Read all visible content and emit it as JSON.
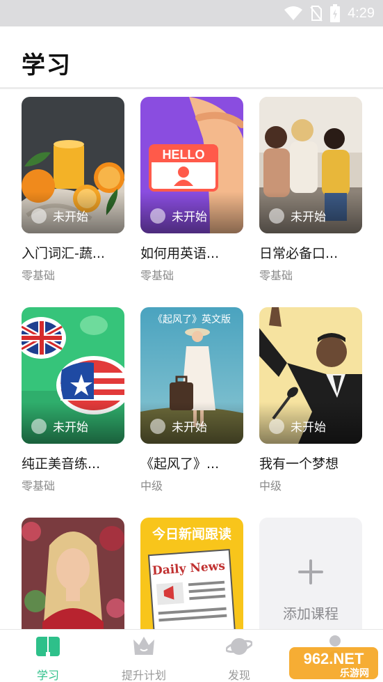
{
  "status_bar": {
    "time": "4:29",
    "icons": [
      "wifi-icon",
      "no-sim-icon",
      "battery-charging-icon"
    ]
  },
  "header": {
    "title": "学习"
  },
  "courses": [
    {
      "title": "入门词汇-蔬...",
      "level": "零基础",
      "status": "未开始",
      "image": "fruit"
    },
    {
      "title": "如何用英语...",
      "level": "零基础",
      "status": "未开始",
      "image": "hello-badge",
      "image_text": "HELLO"
    },
    {
      "title": "日常必备口...",
      "level": "零基础",
      "status": "未开始",
      "image": "friends"
    },
    {
      "title": "纯正美音练...",
      "level": "零基础",
      "status": "未开始",
      "image": "flags"
    },
    {
      "title": "《起风了》...",
      "level": "中级",
      "status": "未开始",
      "image": "woman-suitcase",
      "image_text": "《起风了》英文版"
    },
    {
      "title": "我有一个梦想",
      "level": "中级",
      "status": "未开始",
      "image": "speaker"
    },
    {
      "title": "",
      "level": "",
      "status": "",
      "image": "portrait"
    },
    {
      "title": "",
      "level": "",
      "status": "",
      "image": "daily-news",
      "image_text": "今日新闻跟读",
      "image_subtext": "Daily News"
    }
  ],
  "add_course": {
    "label": "添加课程"
  },
  "bottom_nav": [
    {
      "label": "学习",
      "icon": "book-icon",
      "active": true
    },
    {
      "label": "提升计划",
      "icon": "crown-icon",
      "active": false
    },
    {
      "label": "发现",
      "icon": "planet-icon",
      "active": false
    },
    {
      "label": "",
      "icon": "profile-icon",
      "active": false
    }
  ],
  "watermark": {
    "text": "962.NET",
    "subtext": "乐游网"
  },
  "colors": {
    "accent": "#2ec08a",
    "status_bar": "#dcdcde"
  }
}
